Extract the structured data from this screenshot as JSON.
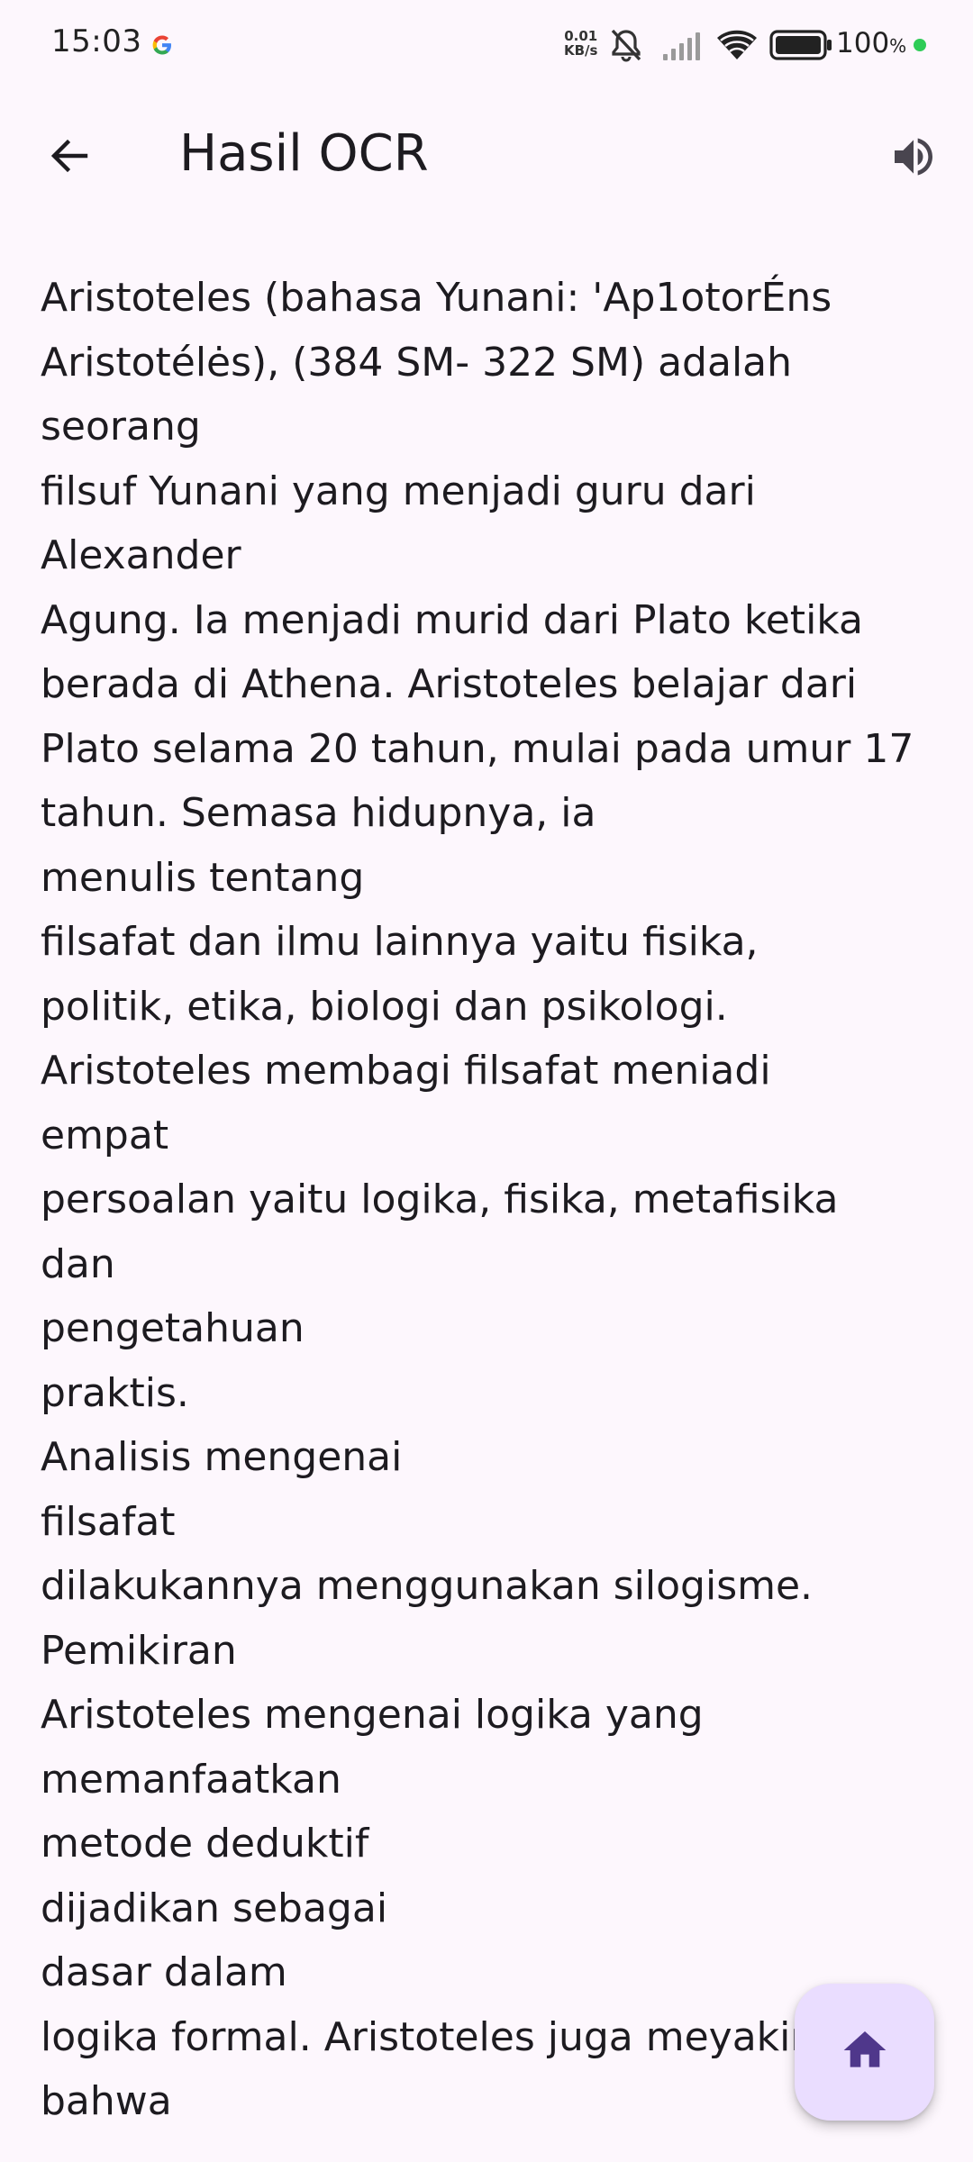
{
  "status_bar": {
    "time": "15:03",
    "net_speed_value": "0.01",
    "net_speed_unit": "KB/s",
    "battery_percent": "100",
    "battery_unit": "%",
    "icons": [
      "google-icon",
      "mute-icon",
      "signal-icon",
      "wifi-icon",
      "battery-icon"
    ]
  },
  "app_bar": {
    "title": "Hasil OCR",
    "back_icon": "arrow-back-icon",
    "speaker_icon": "volume-up-icon"
  },
  "ocr_text": {
    "lines": [
      "Aristoteles (bahasa Yunani: 'Ap1otorÉns",
      "Aristotélės), (384 SM- 322 SM) adalah",
      "seorang",
      "filsuf Yunani yang menjadi guru dari",
      "Alexander",
      "Agung. Ia menjadi murid dari Plato ketika",
      "berada di Athena. Aristoteles belajar dari",
      "Plato selama 20 tahun, mulai pada umur 17",
      "tahun. Semasa hidupnya, ia",
      "menulis tentang",
      "filsafat dan ilmu lainnya yaitu fisika,",
      "politik, etika, biologi dan psikologi.",
      "Aristoteles membagi filsafat meniadi",
      "empat",
      "persoalan yaitu logika, fisika, metafisika",
      "dan",
      "pengetahuan",
      "praktis.",
      "Analisis mengenai",
      "filsafat",
      "dilakukannya menggunakan silogisme.",
      "Pemikiran",
      "Aristoteles mengenai logika yang",
      "memanfaatkan",
      "metode deduktif",
      "dijadikan sebagai",
      "dasar dalam",
      "logika formal. Aristoteles juga meyakini",
      "bahwa"
    ]
  },
  "fab": {
    "icon": "home-icon"
  },
  "colors": {
    "background": "#fdf7fd",
    "text": "#1d1b20",
    "fab_background": "#eaddff",
    "fab_icon": "#4f378b",
    "status_dot": "#2ecc57"
  }
}
